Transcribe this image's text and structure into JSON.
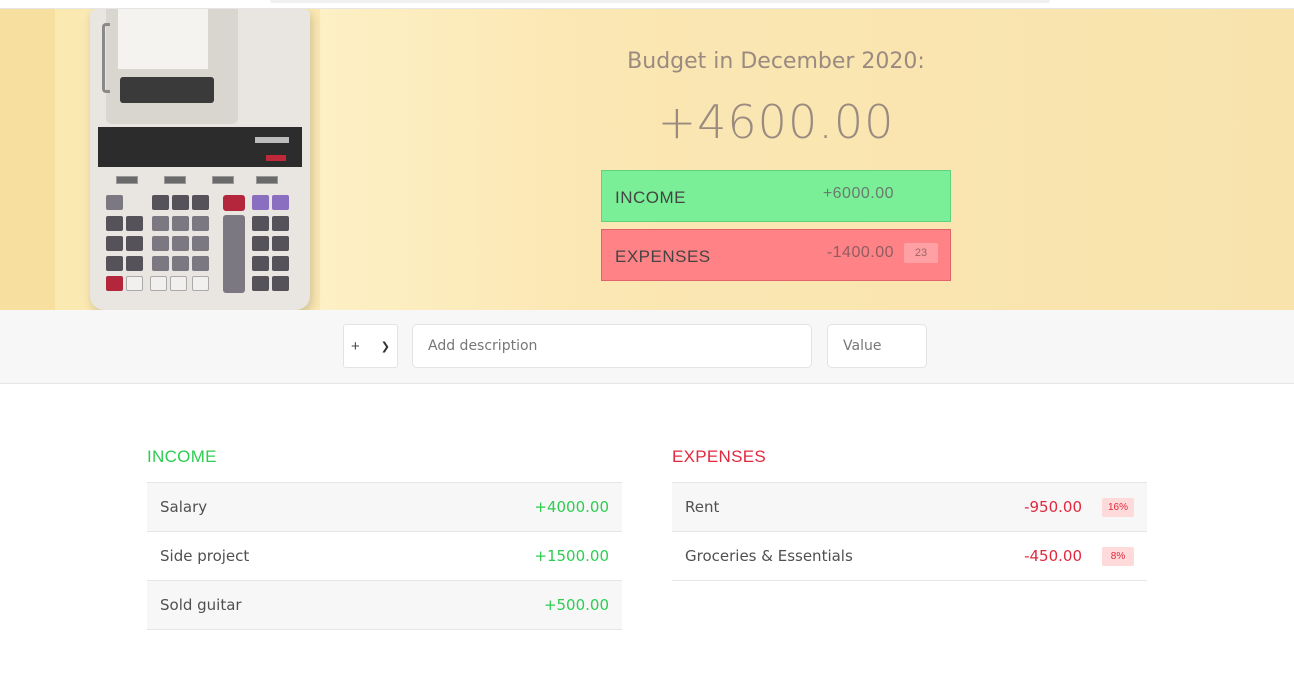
{
  "header": {
    "title": "Budget in December 2020:",
    "budget_value": "+4600.00",
    "income_label": "INCOME",
    "income_value": "+6000.00",
    "expenses_label": "EXPENSES",
    "expenses_value": "-1400.00",
    "expenses_percentage": "23"
  },
  "add_form": {
    "type_selected": "+",
    "description_placeholder": "Add description",
    "value_placeholder": "Value"
  },
  "income": {
    "title": "INCOME",
    "items": [
      {
        "description": "Salary",
        "value": "+4000.00"
      },
      {
        "description": "Side project",
        "value": "+1500.00"
      },
      {
        "description": "Sold guitar",
        "value": "+500.00"
      }
    ]
  },
  "expenses": {
    "title": "EXPENSES",
    "items": [
      {
        "description": "Rent",
        "value": "-950.00",
        "percentage": "16%"
      },
      {
        "description": "Groceries & Essentials",
        "value": "-450.00",
        "percentage": "8%"
      }
    ]
  },
  "colors": {
    "income_accent": "#2ecc51",
    "expenses_accent": "#e2283d",
    "income_box": "#7aef97",
    "expenses_box": "#ff8286",
    "hero_background": "#fbe9b2"
  }
}
